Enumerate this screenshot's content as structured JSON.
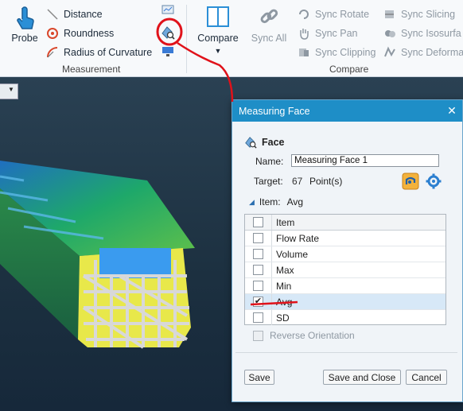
{
  "ribbon": {
    "measurement_group_label": "Measurement",
    "compare_group_label": "Compare",
    "probe_label": "Probe",
    "distance_label": "Distance",
    "roundness_label": "Roundness",
    "radius_label": "Radius of Curvature",
    "compare_label": "Compare",
    "sync_all_label": "Sync All",
    "sync_rotate_label": "Sync Rotate",
    "sync_pan_label": "Sync Pan",
    "sync_clipping_label": "Sync Clipping",
    "sync_slicing_label": "Sync Slicing",
    "sync_isosurface_label": "Sync Isosurfa",
    "sync_deform_label": "Sync Deforma"
  },
  "dialog": {
    "title": "Measuring Face",
    "section_label": "Face",
    "name_label": "Name:",
    "name_value": "Measuring Face 1",
    "target_label": "Target:",
    "target_count": "67",
    "target_unit": "Point(s)",
    "item_label": "Item:",
    "item_value": "Avg",
    "grid_header": "Item",
    "grid_rows": [
      {
        "label": "Flow Rate",
        "checked": false
      },
      {
        "label": "Volume",
        "checked": false
      },
      {
        "label": "Max",
        "checked": false
      },
      {
        "label": "Min",
        "checked": false
      },
      {
        "label": "Avg",
        "checked": true
      },
      {
        "label": "SD",
        "checked": false
      }
    ],
    "reverse_label": "Reverse Orientation",
    "save_label": "Save",
    "save_close_label": "Save and Close",
    "cancel_label": "Cancel",
    "close_glyph": "✕",
    "check_glyph": "✔"
  },
  "colors": {
    "title_bar": "#1e8ec7",
    "annotation": "#e0121a",
    "selected_row": "#d7e8f7"
  }
}
